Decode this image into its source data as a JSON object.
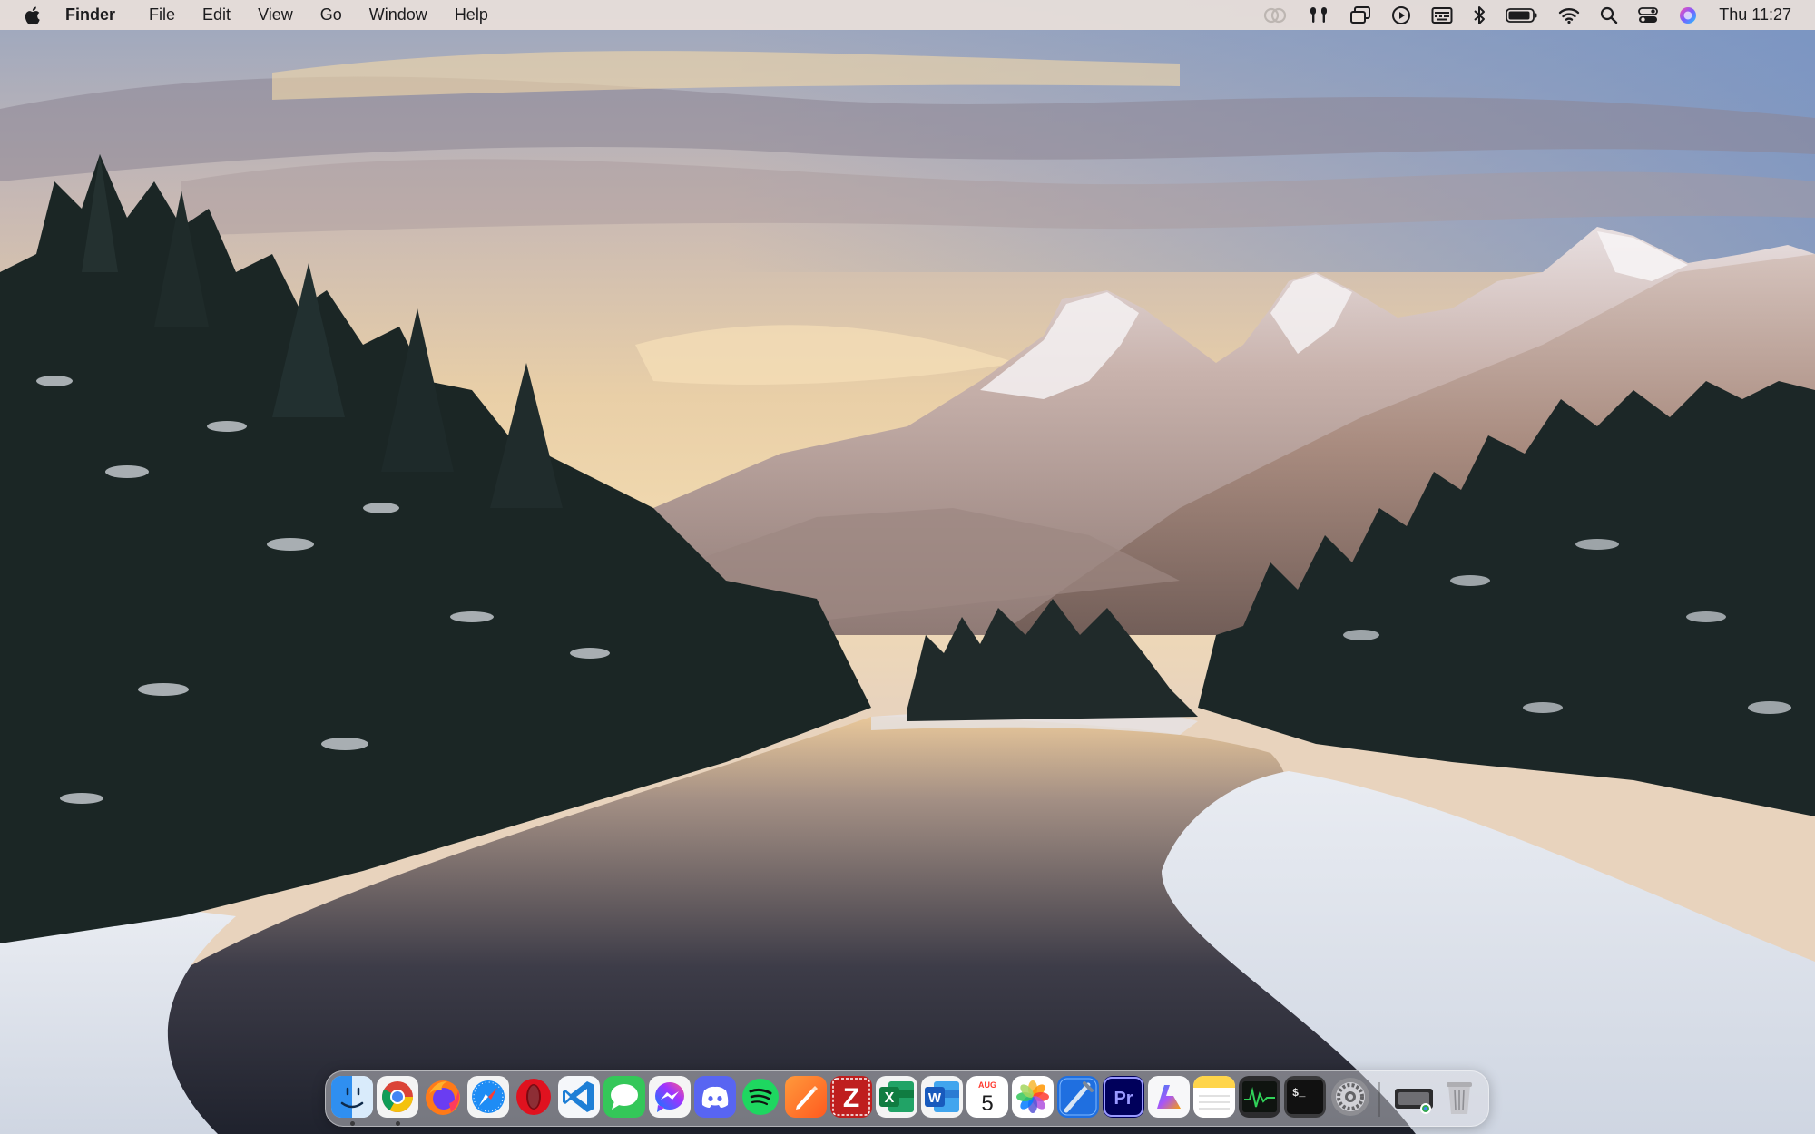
{
  "menubar": {
    "app_name": "Finder",
    "menus": [
      "File",
      "Edit",
      "View",
      "Go",
      "Window",
      "Help"
    ],
    "status_icons": [
      "link-icon",
      "airpods-icon",
      "screen-mirroring-icon",
      "now-playing-icon",
      "keyboard-input-icon",
      "bluetooth-icon",
      "battery-icon",
      "wifi-icon",
      "spotlight-search-icon",
      "control-center-icon",
      "siri-icon"
    ],
    "clock": "Thu 11:27"
  },
  "dock": {
    "apps": [
      {
        "name": "Finder",
        "icon": "finder-icon",
        "running": true
      },
      {
        "name": "Google Chrome",
        "icon": "chrome-icon",
        "running": true
      },
      {
        "name": "Firefox",
        "icon": "firefox-icon",
        "running": false
      },
      {
        "name": "Safari",
        "icon": "safari-icon",
        "running": false
      },
      {
        "name": "Opera",
        "icon": "opera-icon",
        "running": false
      },
      {
        "name": "Visual Studio Code",
        "icon": "vscode-icon",
        "running": false
      },
      {
        "name": "Messages",
        "icon": "messages-icon",
        "running": false
      },
      {
        "name": "Messenger",
        "icon": "messenger-icon",
        "running": false
      },
      {
        "name": "Discord",
        "icon": "discord-icon",
        "running": false
      },
      {
        "name": "Spotify",
        "icon": "spotify-icon",
        "running": false
      },
      {
        "name": "Pixelmator",
        "icon": "pen-app-icon",
        "running": false
      },
      {
        "name": "FileZilla",
        "icon": "filezilla-icon",
        "running": false
      },
      {
        "name": "Microsoft Excel",
        "icon": "excel-icon",
        "running": false
      },
      {
        "name": "Microsoft Word",
        "icon": "word-icon",
        "running": false
      },
      {
        "name": "Calendar",
        "icon": "calendar-icon",
        "running": false
      },
      {
        "name": "Photos",
        "icon": "photos-icon",
        "running": false
      },
      {
        "name": "Xcode",
        "icon": "xcode-icon",
        "running": false
      },
      {
        "name": "Adobe Premiere Pro",
        "icon": "premiere-icon",
        "running": false
      },
      {
        "name": "Copilot",
        "icon": "copilot-icon",
        "running": false
      },
      {
        "name": "Notes",
        "icon": "notes-icon",
        "running": false
      },
      {
        "name": "Activity Monitor",
        "icon": "activity-monitor-icon",
        "running": false
      },
      {
        "name": "Terminal",
        "icon": "terminal-icon",
        "running": false
      },
      {
        "name": "System Settings",
        "icon": "system-settings-icon",
        "running": false
      },
      {
        "name": "Screen Capture",
        "icon": "screen-capture-icon",
        "running": false
      },
      {
        "name": "Trash",
        "icon": "trash-icon",
        "running": false
      }
    ],
    "calendar": {
      "month": "AUG",
      "day": "5"
    },
    "excel_letter": "X",
    "word_letter": "W",
    "premiere_label": "Pr",
    "filezilla_letter": "Z",
    "terminal_prompt": "$_"
  },
  "colors": {
    "menubar_bg": "#e9e0da",
    "sky_top": "#8fa6c8",
    "sky_glow": "#f3d9a6",
    "mountain": "#b59b8f",
    "snow": "#f2f2f4",
    "forest": "#1a2424",
    "river": "#2b2f3a"
  }
}
